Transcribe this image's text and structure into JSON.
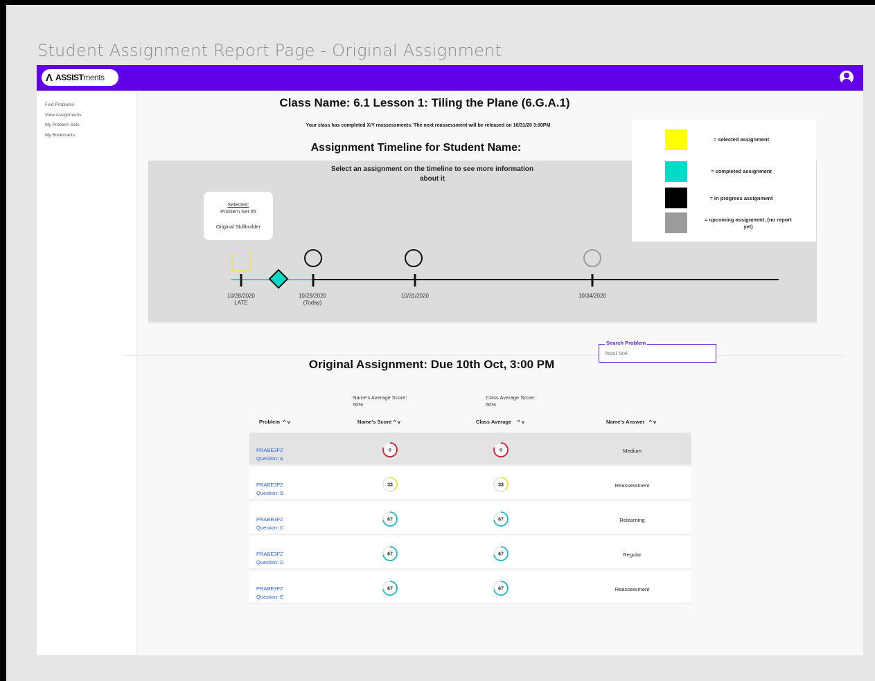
{
  "page_title": "Student Assignment Report Page - Original Assignment",
  "header": {
    "logo_mark": "Λ",
    "logo_bold": "ASSIST",
    "logo_light": "ments",
    "accent": "#5f00e6"
  },
  "sidebar": {
    "items": [
      {
        "label": "Find Problems"
      },
      {
        "label": "View Assignments"
      },
      {
        "label": "My Problem Sets"
      },
      {
        "label": "My Bookmarks"
      }
    ]
  },
  "class": {
    "name": "Class Name: 6.1 Lesson 1: Tiling the Plane (6.G.A.1)",
    "info": "Your class has completed X/Y reassessments. The next reassessment will be released on 10/31/20 3:00PM"
  },
  "timeline": {
    "title": "Assignment Timeline for Student Name:",
    "hint": "Select an assignment on the timeline to see more information about it",
    "selected_label": "Selected:",
    "selected_problem": "Problem Set #5",
    "selected_type": "Original Skillbuilder",
    "dates": [
      {
        "line1": "10/28/2020",
        "line2": "LATE"
      },
      {
        "line1": "10/29/2020",
        "line2": "(Today)"
      },
      {
        "line1": "10/31/2020",
        "line2": ""
      },
      {
        "line1": "10/34/2020",
        "line2": ""
      }
    ]
  },
  "legend": {
    "items": [
      {
        "color": "#ffff00",
        "label": "= selected assignment"
      },
      {
        "color": "#00dcc8",
        "label": "= completed assignment"
      },
      {
        "color": "#000000",
        "label": "= in progress assignment"
      },
      {
        "color": "#9b9b9b",
        "label": "= upcoming assignment, (no report yet)"
      }
    ]
  },
  "search": {
    "label": "Search Problem",
    "placeholder": "Input text"
  },
  "assignment": {
    "title": "Original Assignment: Due 10th Oct, 3:00 PM",
    "name_avg_label": "Name's Average Score:",
    "name_avg_value": "50%",
    "class_avg_label": "Class Average Score:",
    "class_avg_value": "50%"
  },
  "table": {
    "columns": [
      "Problem",
      "Name's Score",
      "Class Average",
      "Name's Answer"
    ],
    "rows": [
      {
        "problem": "PRABE3FZ",
        "question": "Question: A",
        "score": 0,
        "class_avg": 0,
        "answer": "Medium",
        "color": "#cc1f2f"
      },
      {
        "problem": "PRABE3FZ",
        "question": "Question: B",
        "score": 33,
        "class_avg": 33,
        "answer": "Reassessment",
        "color": "#e3e83a"
      },
      {
        "problem": "PRABE3FZ",
        "question": "Question: C",
        "score": 67,
        "class_avg": 67,
        "answer": "Relearning",
        "color": "#1fb9c9"
      },
      {
        "problem": "PRABE3FZ",
        "question": "Question: D",
        "score": 67,
        "class_avg": 67,
        "answer": "Regular",
        "color": "#1fb9c9"
      },
      {
        "problem": "PRABE3FZ",
        "question": "Question: E",
        "score": 67,
        "class_avg": 67,
        "answer": "Reassessment",
        "color": "#1fb9c9"
      }
    ]
  }
}
